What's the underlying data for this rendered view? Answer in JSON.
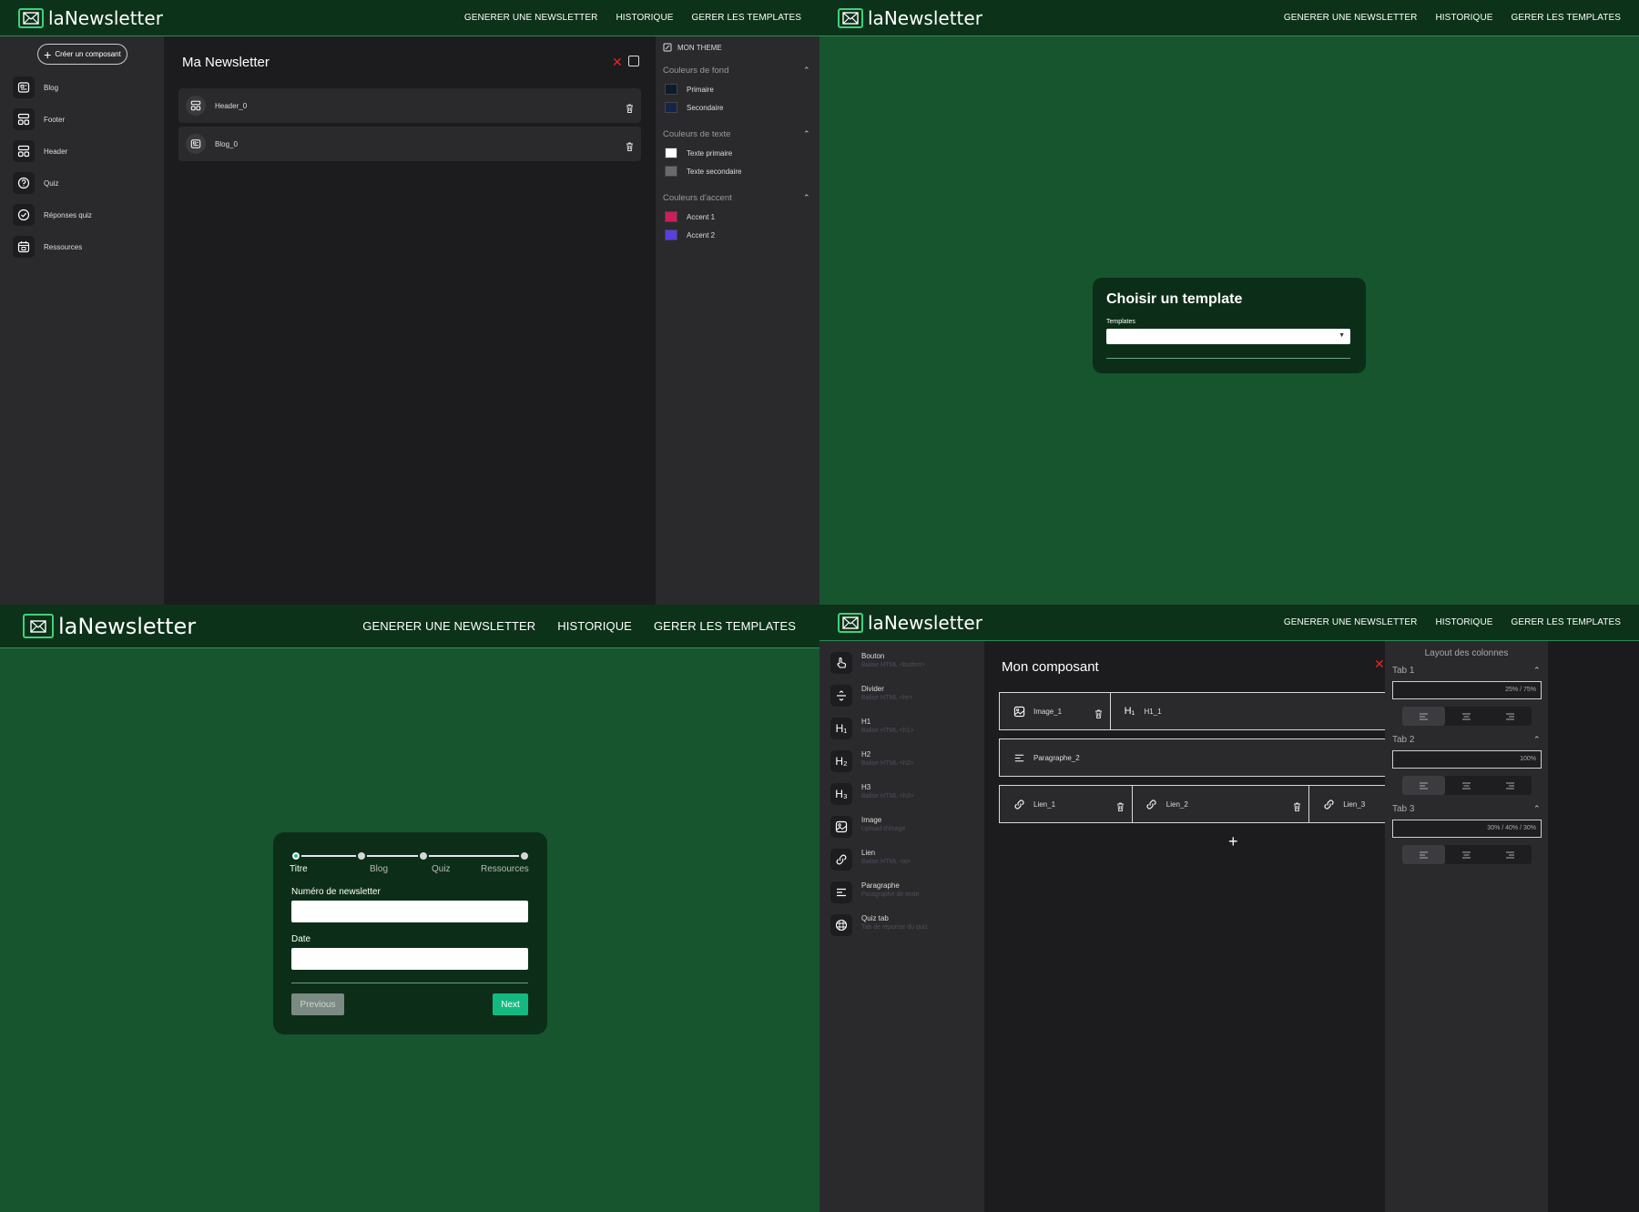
{
  "app": {
    "logo_text": "laNewsletter",
    "nav": [
      "GENERER UNE NEWSLETTER",
      "HISTORIQUE",
      "GERER LES TEMPLATES"
    ]
  },
  "q1": {
    "create_button": "Créer un composant",
    "sidebar": [
      {
        "label": "Blog",
        "icon": "newspaper-icon"
      },
      {
        "label": "Footer",
        "icon": "layout-icon"
      },
      {
        "label": "Header",
        "icon": "layout-icon"
      },
      {
        "label": "Quiz",
        "icon": "question-icon"
      },
      {
        "label": "Réponses quiz",
        "icon": "check-circle-icon"
      },
      {
        "label": "Ressources",
        "icon": "calendar-icon"
      }
    ],
    "title": "Ma Newsletter",
    "components": [
      {
        "label": "Header_0",
        "icon": "layout-icon"
      },
      {
        "label": "Blog_0",
        "icon": "newspaper-icon"
      }
    ],
    "theme": {
      "heading": "MON THEME",
      "sections": [
        {
          "title": "Couleurs de fond",
          "items": [
            {
              "label": "Primaire",
              "color": "#0d1b2e"
            },
            {
              "label": "Secondaire",
              "color": "#15244a"
            }
          ]
        },
        {
          "title": "Couleurs de texte",
          "items": [
            {
              "label": "Texte primaire",
              "color": "#ffffff"
            },
            {
              "label": "Texte secondaire",
              "color": "#6a6a6a"
            }
          ]
        },
        {
          "title": "Couleurs d'accent",
          "items": [
            {
              "label": "Accent 1",
              "color": "#cc1f5a"
            },
            {
              "label": "Accent 2",
              "color": "#5a3ee0"
            }
          ]
        }
      ]
    }
  },
  "q2": {
    "title": "Choisir un template",
    "select_label": "Templates",
    "select_value": ""
  },
  "q3": {
    "steps": [
      "Titre",
      "Blog",
      "Quiz",
      "Ressources"
    ],
    "active_step": 0,
    "field1_label": "Numéro de newsletter",
    "field2_label": "Date",
    "previous": "Previous",
    "next": "Next"
  },
  "q4": {
    "elements": [
      {
        "name": "Bouton",
        "desc": "Balise HTML <button>",
        "icon": "hand-pointer-icon"
      },
      {
        "name": "Divider",
        "desc": "Balise HTML <hr>",
        "icon": "divider-icon"
      },
      {
        "name": "H1",
        "desc": "Balise HTML <h1>",
        "icon": "h1-icon",
        "glyph": "H₁"
      },
      {
        "name": "H2",
        "desc": "Balise HTML <h2>",
        "icon": "h2-icon",
        "glyph": "H₂"
      },
      {
        "name": "H3",
        "desc": "Balise HTML <h3>",
        "icon": "h3-icon",
        "glyph": "H₃"
      },
      {
        "name": "Image",
        "desc": "Upload d'image",
        "icon": "image-icon"
      },
      {
        "name": "Lien",
        "desc": "Balise HTML <a>",
        "icon": "link-icon"
      },
      {
        "name": "Paragraphe",
        "desc": "Paragraphe de texte",
        "icon": "paragraph-icon"
      },
      {
        "name": "Quiz tab",
        "desc": "Tab de réponse du quiz",
        "icon": "grid-icon"
      }
    ],
    "title": "Mon composant",
    "rows": [
      [
        {
          "label": "Image_1",
          "icon": "image-icon"
        },
        {
          "label": "H1_1",
          "icon": "h1-icon",
          "glyph": "H₁"
        }
      ],
      [
        {
          "label": "Paragraphe_2",
          "icon": "paragraph-icon"
        }
      ],
      [
        {
          "label": "Lien_1",
          "icon": "link-icon"
        },
        {
          "label": "Lien_2",
          "icon": "link-icon"
        },
        {
          "label": "Lien_3",
          "icon": "link-icon"
        }
      ]
    ],
    "layout": {
      "title": "Layout des colonnes",
      "tabs": [
        {
          "label": "Tab 1",
          "value": "25% / 75%"
        },
        {
          "label": "Tab 2",
          "value": "100%"
        },
        {
          "label": "Tab 3",
          "value": "30% / 40% / 30%"
        }
      ]
    }
  }
}
